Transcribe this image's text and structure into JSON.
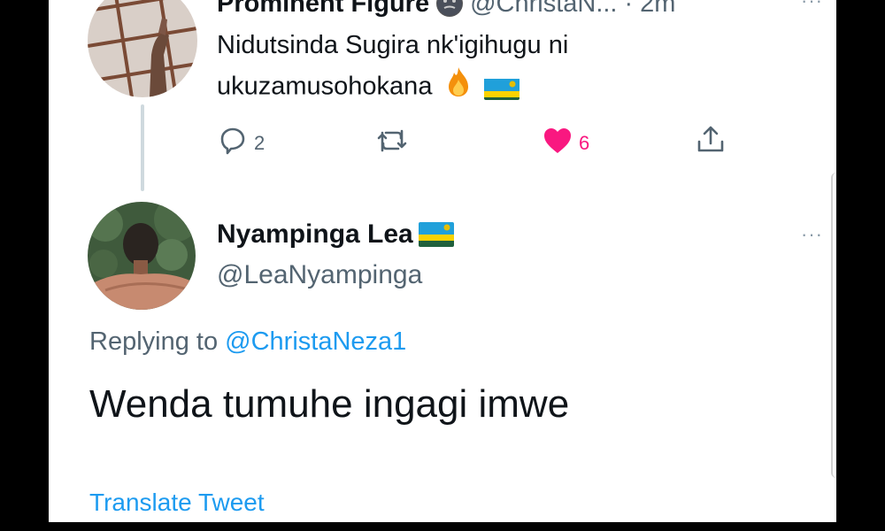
{
  "tweet1": {
    "author_name": "Prominent Figure",
    "handle": "@ChristaN...",
    "separator": "·",
    "time": "2m",
    "text": "Nidutsinda Sugira nk'igihugu ni ukuzamusohokana",
    "reply_count": "2",
    "like_count": "6"
  },
  "tweet2": {
    "author_name": "Nyampinga Lea",
    "handle": "@LeaNyampinga",
    "replying_prefix": "Replying to",
    "replying_handle": "@ChristaNeza1",
    "text": "Wenda tumuhe ingagi imwe",
    "translate_label": "Translate Tweet"
  },
  "colors": {
    "like": "#f91880",
    "link": "#1d9bf0",
    "secondary_text": "#536471",
    "primary_text": "#0f1419"
  },
  "icons": [
    "face-emoji-icon",
    "fire-emoji-icon",
    "rwanda-flag-icon",
    "reply-icon",
    "retweet-icon",
    "like-icon",
    "share-icon",
    "more-icon"
  ]
}
